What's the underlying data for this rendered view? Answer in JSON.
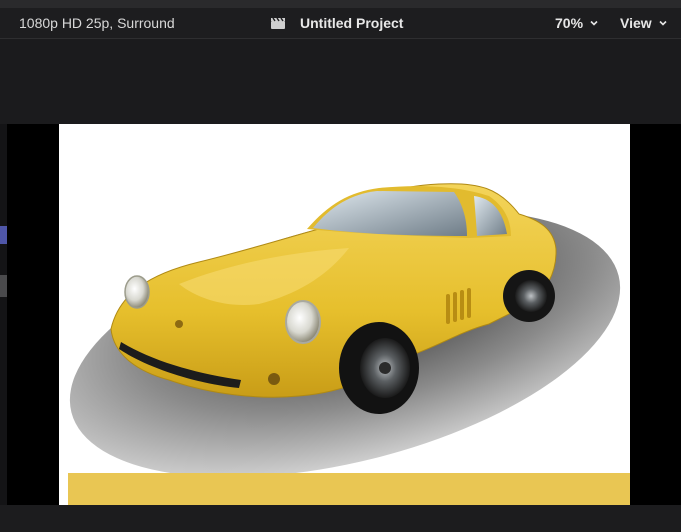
{
  "header": {
    "format": "1080p HD 25p, Surround",
    "project_icon": "clapperboard-icon",
    "project_title": "Untitled Project",
    "zoom": "70%",
    "view_label": "View"
  },
  "viewer": {
    "image_subject": "yellow-classic-sports-car",
    "accent_colors": {
      "car_yellow": "#e9c653",
      "sidebar_blue": "#4f56a8"
    }
  }
}
